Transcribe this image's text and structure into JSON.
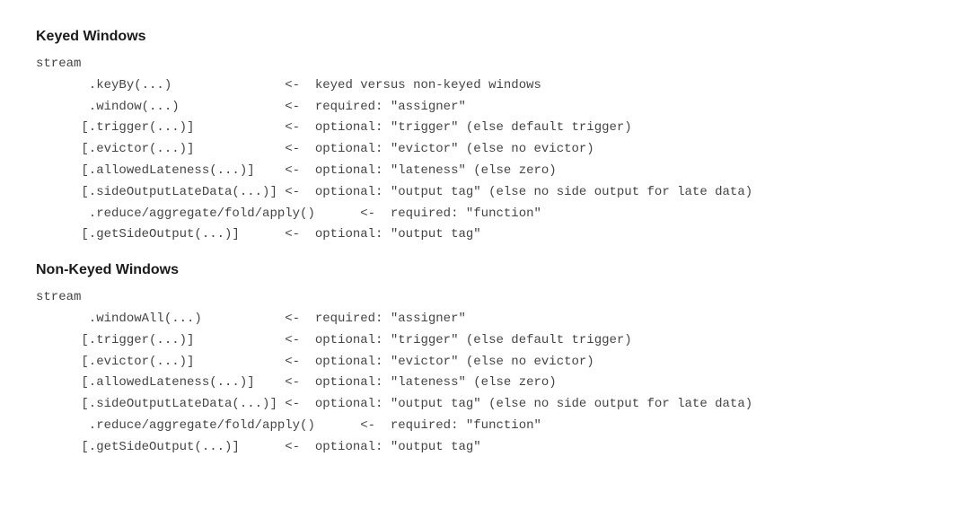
{
  "sections": [
    {
      "heading": "Keyed Windows",
      "lines": [
        "stream",
        "       .keyBy(...)               <-  keyed versus non-keyed windows",
        "       .window(...)              <-  required: \"assigner\"",
        "      [.trigger(...)]            <-  optional: \"trigger\" (else default trigger)",
        "      [.evictor(...)]            <-  optional: \"evictor\" (else no evictor)",
        "      [.allowedLateness(...)]    <-  optional: \"lateness\" (else zero)",
        "      [.sideOutputLateData(...)] <-  optional: \"output tag\" (else no side output for late data)",
        "       .reduce/aggregate/fold/apply()      <-  required: \"function\"",
        "      [.getSideOutput(...)]      <-  optional: \"output tag\""
      ]
    },
    {
      "heading": "Non-Keyed Windows",
      "lines": [
        "stream",
        "       .windowAll(...)           <-  required: \"assigner\"",
        "      [.trigger(...)]            <-  optional: \"trigger\" (else default trigger)",
        "      [.evictor(...)]            <-  optional: \"evictor\" (else no evictor)",
        "      [.allowedLateness(...)]    <-  optional: \"lateness\" (else zero)",
        "      [.sideOutputLateData(...)] <-  optional: \"output tag\" (else no side output for late data)",
        "       .reduce/aggregate/fold/apply()      <-  required: \"function\"",
        "      [.getSideOutput(...)]      <-  optional: \"output tag\""
      ]
    }
  ]
}
